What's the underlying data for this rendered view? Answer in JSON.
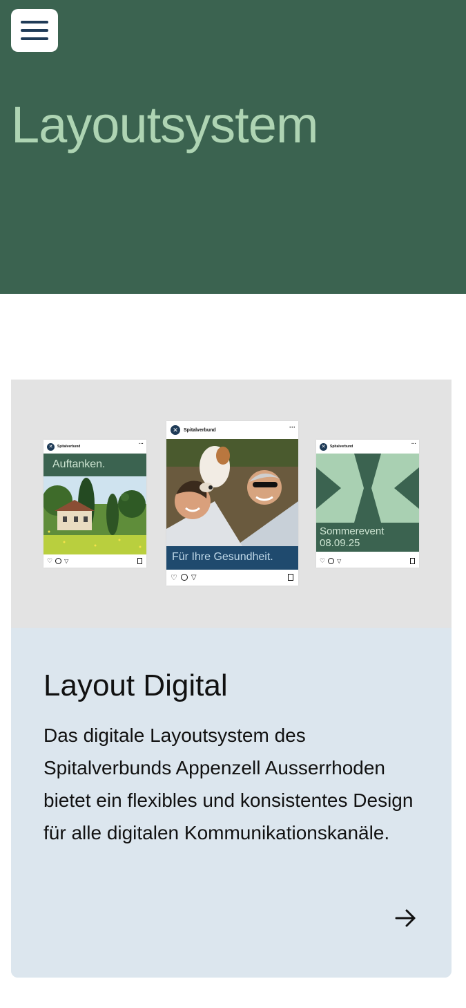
{
  "hero": {
    "menu_icon": "hamburger-menu-icon",
    "title": "Layoutsystem"
  },
  "card": {
    "posts": [
      {
        "account": "Spitalverbund",
        "caption": "Auftanken.",
        "caption_color": "#3b6350"
      },
      {
        "account": "Spitalverbund",
        "caption": "Für Ihre Gesundheit.",
        "caption_color": "#1f4a6e"
      },
      {
        "account": "Spitalverbund",
        "caption_line1": "Sommerevent",
        "caption_line2": "08.09.25",
        "caption_color": "#3b6350"
      }
    ],
    "title": "Layout Digital",
    "text": "Das digitale Layoutsystem des Spitalverbunds Appenzell Ausserrhoden bietet ein flexibles und konsistentes Design für alle digitalen Kommunikationskanäle.",
    "arrow_icon": "arrow-right-icon"
  },
  "colors": {
    "hero_bg": "#3b6350",
    "hero_title": "#aed4b3",
    "media_bg": "#e3e3e3",
    "card_body_bg": "#dce6ee",
    "brand_navy": "#1f3b57",
    "mint": "#a9d0b2"
  }
}
